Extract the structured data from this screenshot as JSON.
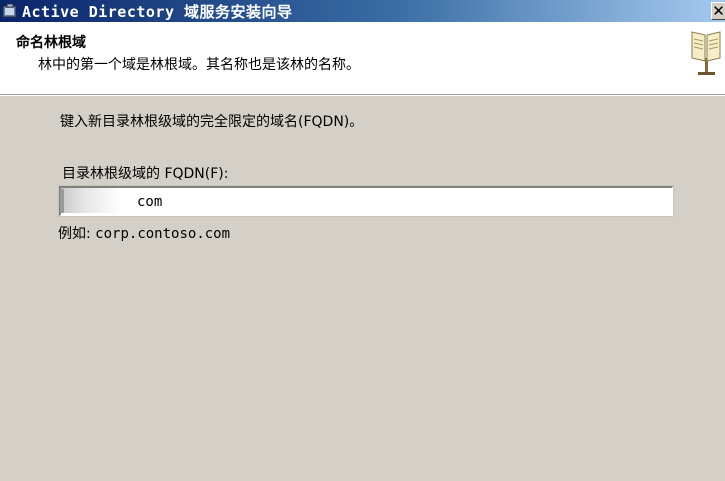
{
  "window": {
    "title": "Active Directory 域服务安装向导",
    "close_glyph": "✕"
  },
  "header": {
    "title": "命名林根域",
    "subtitle": "林中的第一个域是林根域。其名称也是该林的名称。"
  },
  "content": {
    "instruction": "键入新目录林根级域的完全限定的域名(FQDN)。",
    "fqdn_label": "目录林根级域的 FQDN(F):",
    "fqdn_value": "com",
    "example_prefix": "例如:",
    "example_value": "corp.contoso.com"
  },
  "icons": {
    "title_icon": "setup-wizard-icon",
    "header_icon": "book-icon",
    "close_icon": "close-icon"
  },
  "colors": {
    "titlebar_start": "#0a246a",
    "titlebar_end": "#a6caf0",
    "window_bg": "#d4d0c8",
    "header_bg": "#ffffff"
  }
}
